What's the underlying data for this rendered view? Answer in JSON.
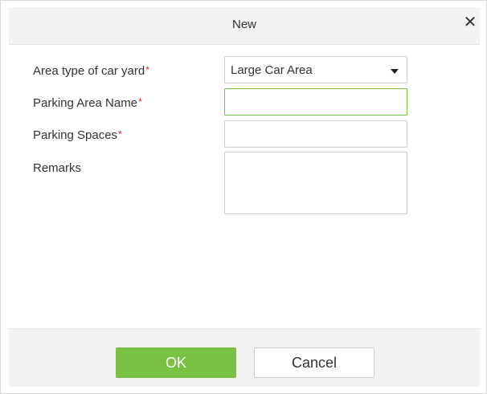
{
  "dialog": {
    "title": "New",
    "close_icon": "close-icon"
  },
  "form": {
    "area_type": {
      "label": "Area type of car yard",
      "required_mark": "*",
      "selected": "Large Car Area"
    },
    "parking_area_name": {
      "label": "Parking Area Name",
      "required_mark": "*",
      "value": ""
    },
    "parking_spaces": {
      "label": "Parking Spaces",
      "required_mark": "*",
      "value": ""
    },
    "remarks": {
      "label": "Remarks",
      "value": ""
    }
  },
  "footer": {
    "ok_label": "OK",
    "cancel_label": "Cancel"
  },
  "colors": {
    "accent": "#7ac143",
    "required": "#e02020",
    "header_bg": "#f2f2f2"
  }
}
